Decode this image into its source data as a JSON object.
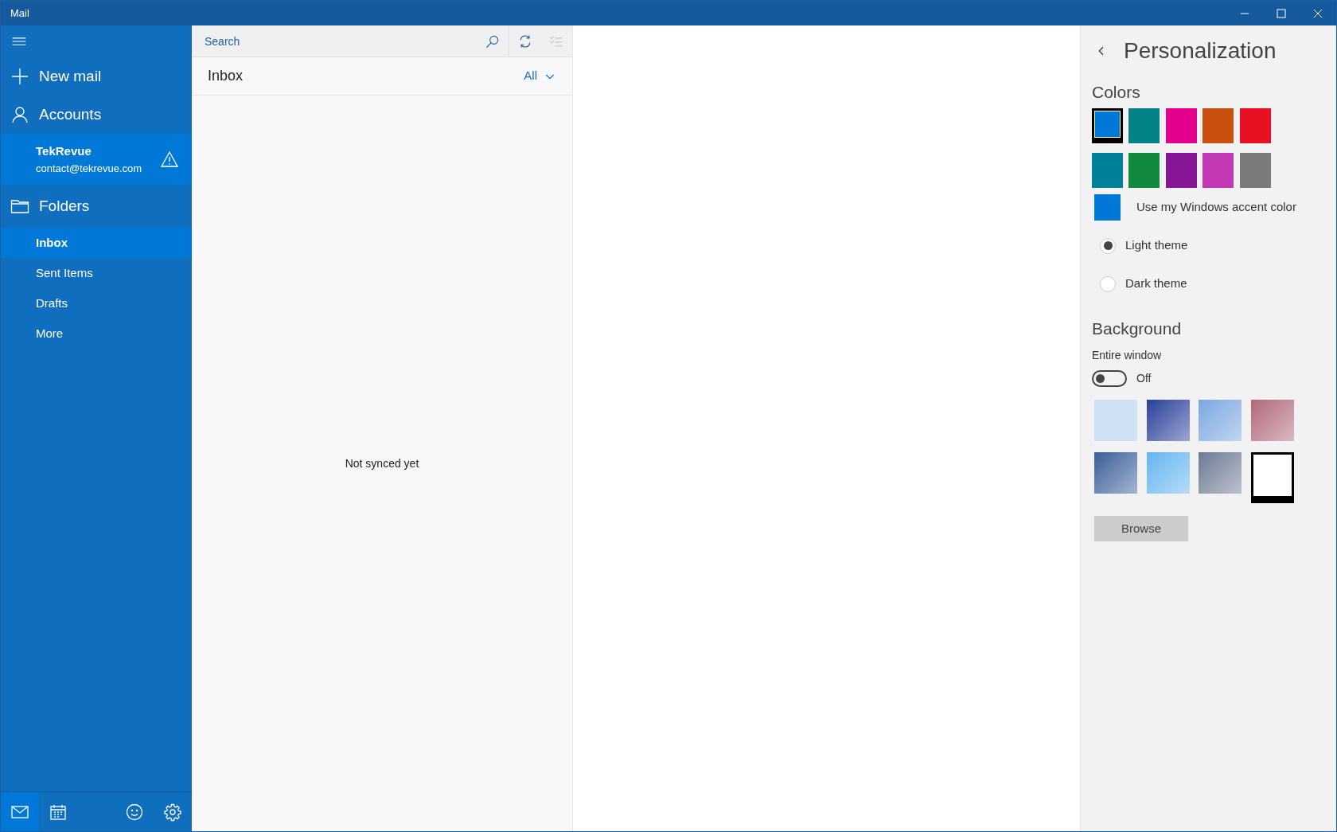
{
  "window": {
    "title": "Mail"
  },
  "sidebar": {
    "new_mail": "New mail",
    "accounts": "Accounts",
    "account": {
      "name": "TekRevue",
      "email": "contact@tekrevue.com",
      "warning": true,
      "selected": true
    },
    "folders_label": "Folders",
    "folders": [
      {
        "label": "Inbox",
        "selected": true
      },
      {
        "label": "Sent Items",
        "selected": false
      },
      {
        "label": "Drafts",
        "selected": false
      },
      {
        "label": "More",
        "selected": false
      }
    ],
    "bottom_nav": [
      {
        "kind": "mail",
        "selected": true
      },
      {
        "kind": "calendar",
        "selected": false
      },
      {
        "kind": "feedback",
        "selected": false
      },
      {
        "kind": "settings",
        "selected": false
      }
    ]
  },
  "message_list": {
    "search": {
      "placeholder": "Search"
    },
    "folder_title": "Inbox",
    "filter": "All",
    "empty_message": "Not synced yet"
  },
  "personalization": {
    "title": "Personalization",
    "colors_heading": "Colors",
    "colors": [
      {
        "color": "#0078d7",
        "selected": true
      },
      {
        "color": "#038387",
        "selected": false
      },
      {
        "color": "#e3008c",
        "selected": false
      },
      {
        "color": "#ca5010",
        "selected": false
      },
      {
        "color": "#e81123",
        "selected": false
      },
      {
        "color": "#00819a",
        "selected": false
      },
      {
        "color": "#10893e",
        "selected": false
      },
      {
        "color": "#881798",
        "selected": false
      },
      {
        "color": "#c239b3",
        "selected": false
      },
      {
        "color": "#7a7a7a",
        "selected": false
      }
    ],
    "accent": {
      "color": "#0078d7",
      "label": "Use my Windows accent color"
    },
    "themes": [
      {
        "label": "Light theme",
        "selected": true
      },
      {
        "label": "Dark theme",
        "selected": false
      }
    ],
    "background_heading": "Background",
    "entire_window": "Entire window",
    "toggle": {
      "on": false,
      "label": "Off"
    },
    "backgrounds": [
      {
        "kind": "solid",
        "color": "#cfe2f3",
        "selected": false
      },
      {
        "kind": "photo",
        "color": "#2a3f9a",
        "selected": false
      },
      {
        "kind": "photo",
        "color": "#7aa6e0",
        "selected": false
      },
      {
        "kind": "photo",
        "color": "#b0687a",
        "selected": false
      },
      {
        "kind": "photo",
        "color": "#3b5f9a",
        "selected": false
      },
      {
        "kind": "photo",
        "color": "#64b4f0",
        "selected": false
      },
      {
        "kind": "photo",
        "color": "#6e7a94",
        "selected": false
      },
      {
        "kind": "solid",
        "color": "#ffffff",
        "selected": true
      }
    ],
    "browse": "Browse"
  }
}
